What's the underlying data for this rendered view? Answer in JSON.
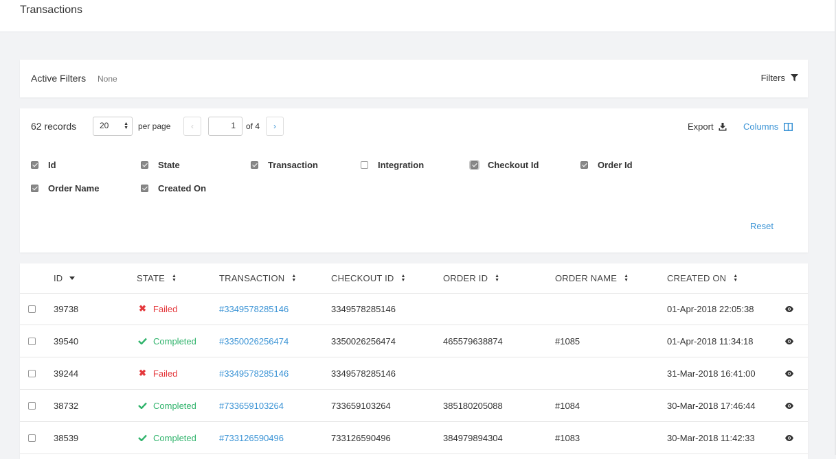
{
  "header": {
    "title": "Transactions"
  },
  "filters": {
    "label": "Active Filters",
    "value": "None",
    "button_label": "Filters"
  },
  "records": {
    "count_label": "62 records",
    "per_page_value": "20",
    "per_page_label": "per page",
    "current_page": "1",
    "of_label": "of 4",
    "export_label": "Export",
    "columns_label": "Columns",
    "reset_label": "Reset"
  },
  "column_options": [
    {
      "label": "Id",
      "checked": true
    },
    {
      "label": "State",
      "checked": true
    },
    {
      "label": "Transaction",
      "checked": true
    },
    {
      "label": "Integration",
      "checked": false
    },
    {
      "label": "Checkout Id",
      "checked": true
    },
    {
      "label": "Order Id",
      "checked": true
    },
    {
      "label": "Order Name",
      "checked": true
    },
    {
      "label": "Created On",
      "checked": true
    }
  ],
  "table": {
    "headers": [
      "ID",
      "STATE",
      "TRANSACTION",
      "CHECKOUT ID",
      "ORDER ID",
      "ORDER NAME",
      "CREATED ON"
    ],
    "rows": [
      {
        "id": "39738",
        "state": "Failed",
        "transaction": "#3349578285146",
        "checkout_id": "3349578285146",
        "order_id": "",
        "order_name": "",
        "created_on": "01-Apr-2018 22:05:38"
      },
      {
        "id": "39540",
        "state": "Completed",
        "transaction": "#3350026256474",
        "checkout_id": "3350026256474",
        "order_id": "465579638874",
        "order_name": "#1085",
        "created_on": "01-Apr-2018 11:34:18"
      },
      {
        "id": "39244",
        "state": "Failed",
        "transaction": "#3349578285146",
        "checkout_id": "3349578285146",
        "order_id": "",
        "order_name": "",
        "created_on": "31-Mar-2018 16:41:00"
      },
      {
        "id": "38732",
        "state": "Completed",
        "transaction": "#733659103264",
        "checkout_id": "733659103264",
        "order_id": "385180205088",
        "order_name": "#1084",
        "created_on": "30-Mar-2018 17:46:44"
      },
      {
        "id": "38539",
        "state": "Completed",
        "transaction": "#733126590496",
        "checkout_id": "733126590496",
        "order_id": "384979894304",
        "order_name": "#1083",
        "created_on": "30-Mar-2018 11:42:33"
      }
    ]
  },
  "colors": {
    "accent": "#3a93d5",
    "failed": "#e4383c",
    "completed": "#2fb36b"
  },
  "icons": {
    "filter": "filter-icon",
    "export": "download-icon",
    "columns": "columns-icon",
    "failed": "x-icon",
    "completed": "check-icon",
    "view": "eye-icon"
  }
}
